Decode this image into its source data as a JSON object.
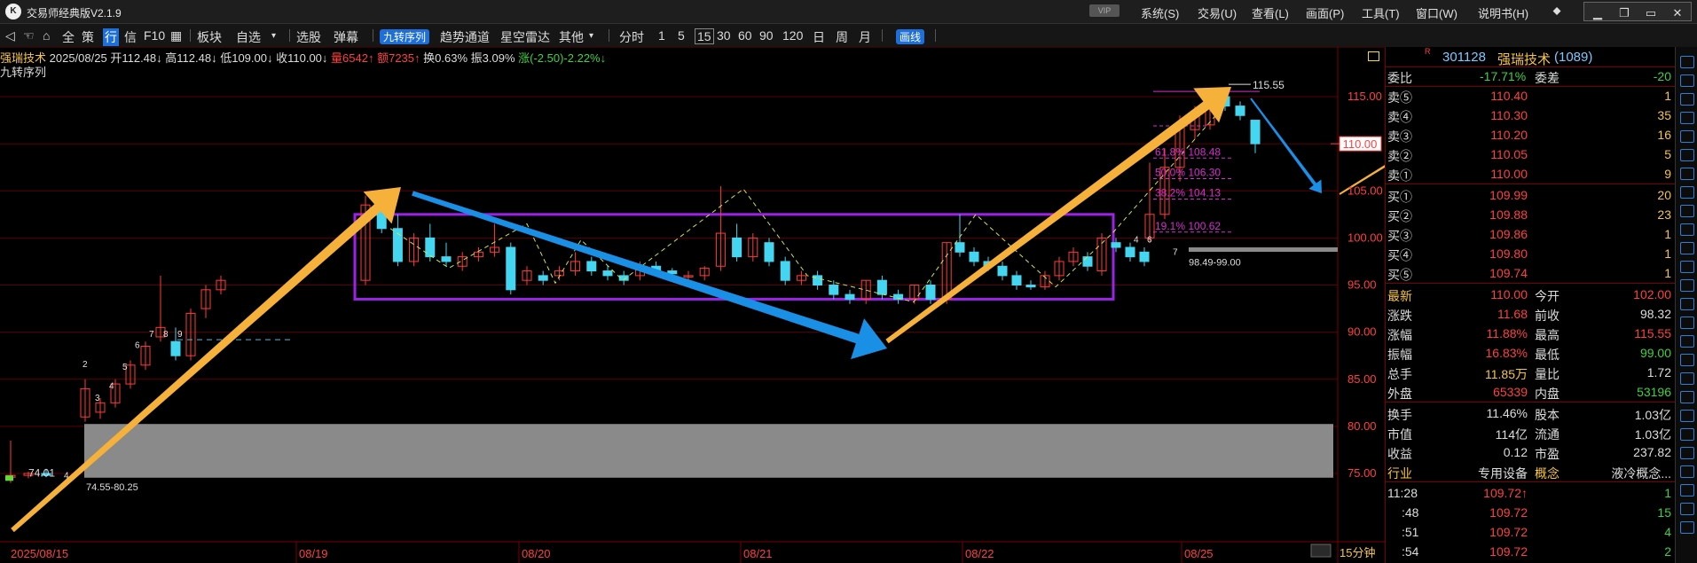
{
  "app": {
    "title": "交易师经典版V2.1.9",
    "logo_text": "K",
    "vip": "VIP",
    "menus": [
      "系统(S)",
      "交易(U)",
      "查看(L)",
      "画面(P)",
      "工具(T)",
      "窗口(W)",
      "说明书(H)"
    ]
  },
  "toolbar": {
    "items": [
      "全",
      "策",
      "行",
      "信",
      "F10",
      "板块",
      "自选",
      "选股",
      "弹幕"
    ],
    "highlight": "九转序列",
    "items2": [
      "趋势通道",
      "星空雷达",
      "其他",
      "分时",
      "1",
      "5",
      "15",
      "30",
      "60",
      "90",
      "120",
      "日",
      "周",
      "月"
    ],
    "draw_button": "画线",
    "active_item": "行",
    "selected_period": "15"
  },
  "stock_info": {
    "name": "强瑞技术",
    "date": "2025/08/25",
    "open": "开112.48↓",
    "high": "高112.48↓",
    "low": "低109.00↓",
    "close": "收110.00↓",
    "volume": "量6542↑",
    "amount": "额7235↑",
    "turnover": "换0.63%",
    "amplitude": "振3.09%",
    "change": "涨(-2.50)-2.22%↓",
    "indicator": "九转序列"
  },
  "colors": {
    "up": "#ff3c3c",
    "down": "#44d6f0",
    "box": "#9b22e6",
    "arrow_up": "#f6b13a",
    "arrow_down": "#1a8fe6",
    "fib": "#d62ecf",
    "grid": "#5a0000"
  },
  "chart_data": {
    "type": "candlestick",
    "period": "15分钟",
    "y_axis_ticks": [
      "115.00",
      "110.00",
      "105.00",
      "100.00",
      "95.00",
      "90.00",
      "85.00",
      "80.00",
      "75.00"
    ],
    "ylim": [
      74.5,
      116.5
    ],
    "x_labels": [
      "2025/08/15",
      "08/19",
      "08/20",
      "08/21",
      "08/22",
      "08/25"
    ],
    "last_price_label": "110.00",
    "high_label": "115.55",
    "low_label": "74.01",
    "zone_low_label": "74.55-80.25",
    "zone_high_label": "98.49-99.00",
    "period_label": "15分钟",
    "fibonacci": [
      {
        "label": "61.8%",
        "value": "108.48"
      },
      {
        "label": "50.0%",
        "value": "106.30"
      },
      {
        "label": "38.2%",
        "value": "104.13"
      },
      {
        "label": "19.1%",
        "value": "100.62"
      }
    ],
    "candles": [
      {
        "x": 0,
        "o": 74.6,
        "h": 78.5,
        "l": 74.0,
        "c": 74.8
      },
      {
        "x": 1,
        "o": 74.8,
        "h": 75.2,
        "l": 74.5,
        "c": 75.0
      },
      {
        "x": 2,
        "o": 75.0,
        "h": 75.5,
        "l": 74.6,
        "c": 74.8
      },
      {
        "x": 3,
        "o": 81.0,
        "h": 85.0,
        "l": 80.5,
        "c": 84.0
      },
      {
        "x": 4,
        "o": 81.5,
        "h": 83.0,
        "l": 80.8,
        "c": 82.5
      },
      {
        "x": 5,
        "o": 82.5,
        "h": 85.0,
        "l": 82.0,
        "c": 84.5
      },
      {
        "x": 6,
        "o": 84.5,
        "h": 87.0,
        "l": 84.0,
        "c": 86.5
      },
      {
        "x": 7,
        "o": 86.5,
        "h": 89.0,
        "l": 86.0,
        "c": 88.5
      },
      {
        "x": 8,
        "o": 89.5,
        "h": 96.0,
        "l": 89.0,
        "c": 90.5
      },
      {
        "x": 9,
        "o": 89.0,
        "h": 90.5,
        "l": 87.0,
        "c": 87.5
      },
      {
        "x": 10,
        "o": 87.5,
        "h": 92.5,
        "l": 87.0,
        "c": 92.0
      },
      {
        "x": 11,
        "o": 92.5,
        "h": 95.0,
        "l": 91.5,
        "c": 94.5
      },
      {
        "x": 12,
        "o": 94.5,
        "h": 96.0,
        "l": 94.0,
        "c": 95.5
      },
      {
        "x": 13,
        "o": 95.5,
        "h": 104.5,
        "l": 95.0,
        "c": 103.5
      },
      {
        "x": 14,
        "o": 104.0,
        "h": 105.0,
        "l": 100.5,
        "c": 101.0
      },
      {
        "x": 15,
        "o": 101.0,
        "h": 102.5,
        "l": 97.0,
        "c": 97.5
      },
      {
        "x": 16,
        "o": 97.5,
        "h": 100.5,
        "l": 97.0,
        "c": 100.0
      },
      {
        "x": 17,
        "o": 100.0,
        "h": 101.5,
        "l": 97.5,
        "c": 98.0
      },
      {
        "x": 18,
        "o": 98.0,
        "h": 99.5,
        "l": 97.0,
        "c": 97.5
      },
      {
        "x": 19,
        "o": 97.0,
        "h": 98.5,
        "l": 96.5,
        "c": 98.0
      },
      {
        "x": 20,
        "o": 98.0,
        "h": 99.0,
        "l": 97.5,
        "c": 98.5
      },
      {
        "x": 21,
        "o": 98.5,
        "h": 101.5,
        "l": 98.0,
        "c": 99.0
      },
      {
        "x": 22,
        "o": 99.0,
        "h": 99.5,
        "l": 94.0,
        "c": 94.5
      },
      {
        "x": 23,
        "o": 95.5,
        "h": 97.0,
        "l": 95.0,
        "c": 96.5
      },
      {
        "x": 24,
        "o": 96.0,
        "h": 96.5,
        "l": 95.0,
        "c": 95.5
      },
      {
        "x": 25,
        "o": 96.0,
        "h": 97.0,
        "l": 95.5,
        "c": 96.5
      },
      {
        "x": 26,
        "o": 96.5,
        "h": 98.5,
        "l": 96.0,
        "c": 97.5
      },
      {
        "x": 27,
        "o": 97.5,
        "h": 98.0,
        "l": 96.0,
        "c": 96.5
      },
      {
        "x": 28,
        "o": 96.5,
        "h": 97.0,
        "l": 95.5,
        "c": 96.0
      },
      {
        "x": 29,
        "o": 96.0,
        "h": 96.5,
        "l": 95.0,
        "c": 95.5
      },
      {
        "x": 30,
        "o": 96.0,
        "h": 97.5,
        "l": 95.5,
        "c": 97.0
      },
      {
        "x": 31,
        "o": 97.0,
        "h": 97.5,
        "l": 96.0,
        "c": 96.5
      },
      {
        "x": 32,
        "o": 96.5,
        "h": 96.8,
        "l": 96.0,
        "c": 96.2
      },
      {
        "x": 33,
        "o": 96.0,
        "h": 96.5,
        "l": 95.5,
        "c": 96.0
      },
      {
        "x": 34,
        "o": 96.0,
        "h": 97.0,
        "l": 95.5,
        "c": 96.8
      },
      {
        "x": 35,
        "o": 97.0,
        "h": 105.5,
        "l": 96.5,
        "c": 100.5
      },
      {
        "x": 36,
        "o": 100.0,
        "h": 101.5,
        "l": 97.5,
        "c": 98.0
      },
      {
        "x": 37,
        "o": 98.0,
        "h": 100.5,
        "l": 97.5,
        "c": 100.0
      },
      {
        "x": 38,
        "o": 99.5,
        "h": 100.0,
        "l": 97.0,
        "c": 97.5
      },
      {
        "x": 39,
        "o": 97.5,
        "h": 98.0,
        "l": 95.0,
        "c": 95.5
      },
      {
        "x": 40,
        "o": 95.5,
        "h": 96.5,
        "l": 95.0,
        "c": 96.0
      },
      {
        "x": 41,
        "o": 96.0,
        "h": 96.5,
        "l": 94.5,
        "c": 95.0
      },
      {
        "x": 42,
        "o": 95.0,
        "h": 95.5,
        "l": 93.5,
        "c": 94.0
      },
      {
        "x": 43,
        "o": 94.0,
        "h": 94.5,
        "l": 93.0,
        "c": 93.5
      },
      {
        "x": 44,
        "o": 93.5,
        "h": 95.5,
        "l": 93.0,
        "c": 95.5
      },
      {
        "x": 45,
        "o": 95.5,
        "h": 96.0,
        "l": 93.5,
        "c": 94.0
      },
      {
        "x": 46,
        "o": 94.0,
        "h": 94.5,
        "l": 93.0,
        "c": 93.5
      },
      {
        "x": 47,
        "o": 93.5,
        "h": 95.0,
        "l": 93.0,
        "c": 95.0
      },
      {
        "x": 48,
        "o": 95.0,
        "h": 95.5,
        "l": 93.0,
        "c": 93.5
      },
      {
        "x": 49,
        "o": 93.5,
        "h": 99.5,
        "l": 93.0,
        "c": 99.5
      },
      {
        "x": 50,
        "o": 99.5,
        "h": 102.5,
        "l": 98.0,
        "c": 98.5
      },
      {
        "x": 51,
        "o": 98.5,
        "h": 99.0,
        "l": 97.0,
        "c": 97.5
      },
      {
        "x": 52,
        "o": 97.5,
        "h": 98.0,
        "l": 96.5,
        "c": 97.0
      },
      {
        "x": 53,
        "o": 97.0,
        "h": 97.5,
        "l": 95.5,
        "c": 96.0
      },
      {
        "x": 54,
        "o": 96.0,
        "h": 96.5,
        "l": 94.5,
        "c": 95.0
      },
      {
        "x": 55,
        "o": 95.0,
        "h": 95.5,
        "l": 94.5,
        "c": 94.8
      },
      {
        "x": 56,
        "o": 94.8,
        "h": 96.5,
        "l": 94.5,
        "c": 96.0
      },
      {
        "x": 57,
        "o": 96.0,
        "h": 98.0,
        "l": 95.5,
        "c": 97.5
      },
      {
        "x": 58,
        "o": 97.5,
        "h": 99.0,
        "l": 97.0,
        "c": 98.5
      },
      {
        "x": 59,
        "o": 98.0,
        "h": 98.5,
        "l": 96.5,
        "c": 97.0
      },
      {
        "x": 60,
        "o": 96.5,
        "h": 100.5,
        "l": 96.0,
        "c": 100.0
      },
      {
        "x": 61,
        "o": 99.5,
        "h": 100.0,
        "l": 98.5,
        "c": 99.0
      },
      {
        "x": 62,
        "o": 99.0,
        "h": 99.5,
        "l": 97.5,
        "c": 98.0
      },
      {
        "x": 63,
        "o": 98.5,
        "h": 99.0,
        "l": 97.0,
        "c": 97.5
      },
      {
        "x": 64,
        "o": 100.0,
        "h": 108.0,
        "l": 99.5,
        "c": 102.5
      },
      {
        "x": 65,
        "o": 102.5,
        "h": 109.5,
        "l": 102.0,
        "c": 107.5
      },
      {
        "x": 66,
        "o": 107.5,
        "h": 113.0,
        "l": 106.0,
        "c": 112.0
      },
      {
        "x": 67,
        "o": 111.5,
        "h": 114.0,
        "l": 110.5,
        "c": 113.0
      },
      {
        "x": 68,
        "o": 112.0,
        "h": 115.55,
        "l": 111.5,
        "c": 115.0
      },
      {
        "x": 69,
        "o": 115.0,
        "h": 115.5,
        "l": 113.5,
        "c": 114.0
      },
      {
        "x": 70,
        "o": 114.0,
        "h": 114.5,
        "l": 112.5,
        "c": 113.0
      },
      {
        "x": 71,
        "o": 112.5,
        "h": 112.5,
        "l": 109.0,
        "c": 110.0
      }
    ]
  },
  "quote": {
    "code": "301128",
    "name": "强瑞技术",
    "rank": "(1089)",
    "webi_label": "委比",
    "webi_value": "-17.71%",
    "weicha_label": "委差",
    "weicha_value": "-20",
    "asks": [
      {
        "label": "卖⑤",
        "price": "110.40",
        "vol": "1"
      },
      {
        "label": "卖④",
        "price": "110.30",
        "vol": "35"
      },
      {
        "label": "卖③",
        "price": "110.20",
        "vol": "16"
      },
      {
        "label": "卖②",
        "price": "110.05",
        "vol": "5"
      },
      {
        "label": "卖①",
        "price": "110.00",
        "vol": "9"
      }
    ],
    "bids": [
      {
        "label": "买①",
        "price": "109.99",
        "vol": "20"
      },
      {
        "label": "买②",
        "price": "109.88",
        "vol": "23"
      },
      {
        "label": "买③",
        "price": "109.86",
        "vol": "1"
      },
      {
        "label": "买④",
        "price": "109.80",
        "vol": "1"
      },
      {
        "label": "买⑤",
        "price": "109.74",
        "vol": "1"
      }
    ],
    "stats": [
      {
        "l1": "最新",
        "v1": "110.00",
        "l2": "今开",
        "v2": "102.00"
      },
      {
        "l1": "涨跌",
        "v1": "11.68",
        "l2": "前收",
        "v2": "98.32"
      },
      {
        "l1": "涨幅",
        "v1": "11.88%",
        "l2": "最高",
        "v2": "115.55"
      },
      {
        "l1": "振幅",
        "v1": "16.83%",
        "l2": "最低",
        "v2": "99.00"
      },
      {
        "l1": "总手",
        "v1": "11.85万",
        "l2": "量比",
        "v2": "1.72"
      },
      {
        "l1": "外盘",
        "v1": "65339",
        "l2": "内盘",
        "v2": "53196"
      }
    ],
    "stats2": [
      {
        "l1": "换手",
        "v1": "11.46%",
        "l2": "股本",
        "v2": "1.03亿"
      },
      {
        "l1": "市值",
        "v1": "114亿",
        "l2": "流通",
        "v2": "1.03亿"
      },
      {
        "l1": "收益",
        "v1": "0.12",
        "l2": "市盈",
        "v2": "237.82"
      },
      {
        "l1": "行业",
        "v1": "专用设备",
        "l2": "概念",
        "v2": "液冷概念..."
      }
    ],
    "ticks": [
      {
        "time": "11:28",
        "price": "109.72↑",
        "vol": "1"
      },
      {
        "time": ":48",
        "price": "109.72",
        "vol": "15"
      },
      {
        "time": ":51",
        "price": "109.72",
        "vol": "4"
      },
      {
        "time": ":54",
        "price": "109.72",
        "vol": "2"
      }
    ]
  }
}
